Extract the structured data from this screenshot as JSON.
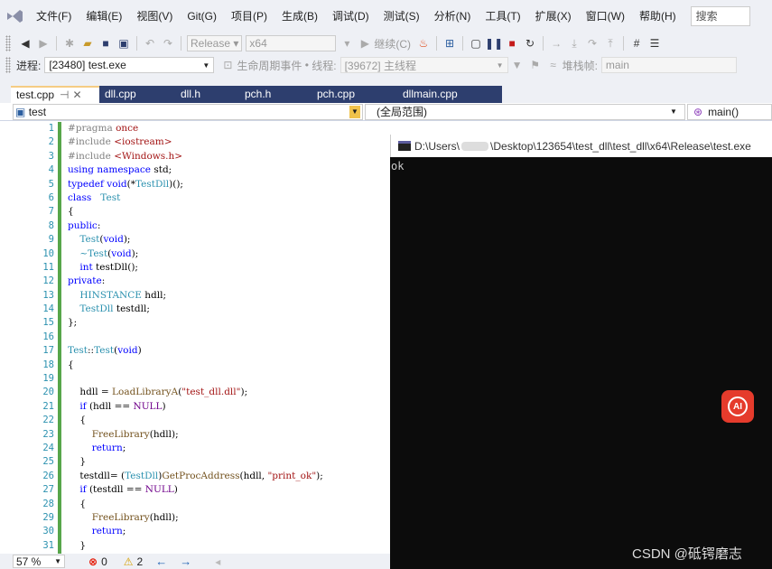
{
  "menubar": {
    "items": [
      "文件(F)",
      "编辑(E)",
      "视图(V)",
      "Git(G)",
      "项目(P)",
      "生成(B)",
      "调试(D)",
      "测试(S)",
      "分析(N)",
      "工具(T)",
      "扩展(X)",
      "窗口(W)",
      "帮助(H)"
    ],
    "search_placeholder": "搜索"
  },
  "toolbar": {
    "config": "Release",
    "platform": "x64",
    "continue_label": "继续(C)"
  },
  "debugbar": {
    "process_label": "进程:",
    "process_value": "[23480] test.exe",
    "lifecycle_label": "生命周期事件",
    "thread_label": "线程:",
    "thread_value": "[39672] 主线程",
    "stack_label": "堆栈帧:",
    "stack_value": "main"
  },
  "tabs": [
    "test.cpp",
    "dll.cpp",
    "dll.h",
    "pch.h",
    "pch.cpp",
    "dllmain.cpp"
  ],
  "navbar": {
    "project": "test",
    "scope": "(全局范围)",
    "member": "main()"
  },
  "editor": {
    "line_numbers": [
      "1",
      "2",
      "3",
      "4",
      "5",
      "6",
      "7",
      "8",
      "9",
      "10",
      "11",
      "12",
      "13",
      "14",
      "15",
      "16",
      "17",
      "18",
      "19",
      "20",
      "21",
      "22",
      "23",
      "24",
      "25",
      "26",
      "27",
      "28",
      "29",
      "30",
      "31"
    ],
    "lines": [
      "#pragma once",
      "#include <iostream>",
      "#include <Windows.h>",
      "using namespace std;",
      "typedef void(*TestDll)();",
      "class   Test",
      "{",
      "public:",
      "    Test(void);",
      "    ~Test(void);",
      "    int testDll();",
      "private:",
      "    HINSTANCE hdll;",
      "    TestDll testdll;",
      "};",
      "",
      "Test::Test(void)",
      "{",
      "",
      "    hdll = LoadLibraryA(\"test_dll.dll\");",
      "    if (hdll == NULL)",
      "    {",
      "        FreeLibrary(hdll);",
      "        return;",
      "    }",
      "    testdll= (TestDll)GetProcAddress(hdll, \"print_ok\");",
      "    if (testdll == NULL)",
      "    {",
      "        FreeLibrary(hdll);",
      "        return;",
      "    }"
    ]
  },
  "console": {
    "title_prefix": "D:\\Users\\",
    "title_suffix": "\\Desktop\\123654\\test_dll\\test_dll\\x64\\Release\\test.exe",
    "output": "ok"
  },
  "statusbar": {
    "zoom": "57 %",
    "errors": "0",
    "warnings": "2"
  },
  "overlay": {
    "ai_label": "AI",
    "watermark": "CSDN @砥锷磨志"
  },
  "colors": {
    "accent": "#2d3e6e",
    "console_bg": "#0c0c0c",
    "line_number": "#2b91af",
    "keyword": "#0000ff",
    "string": "#a31515"
  }
}
